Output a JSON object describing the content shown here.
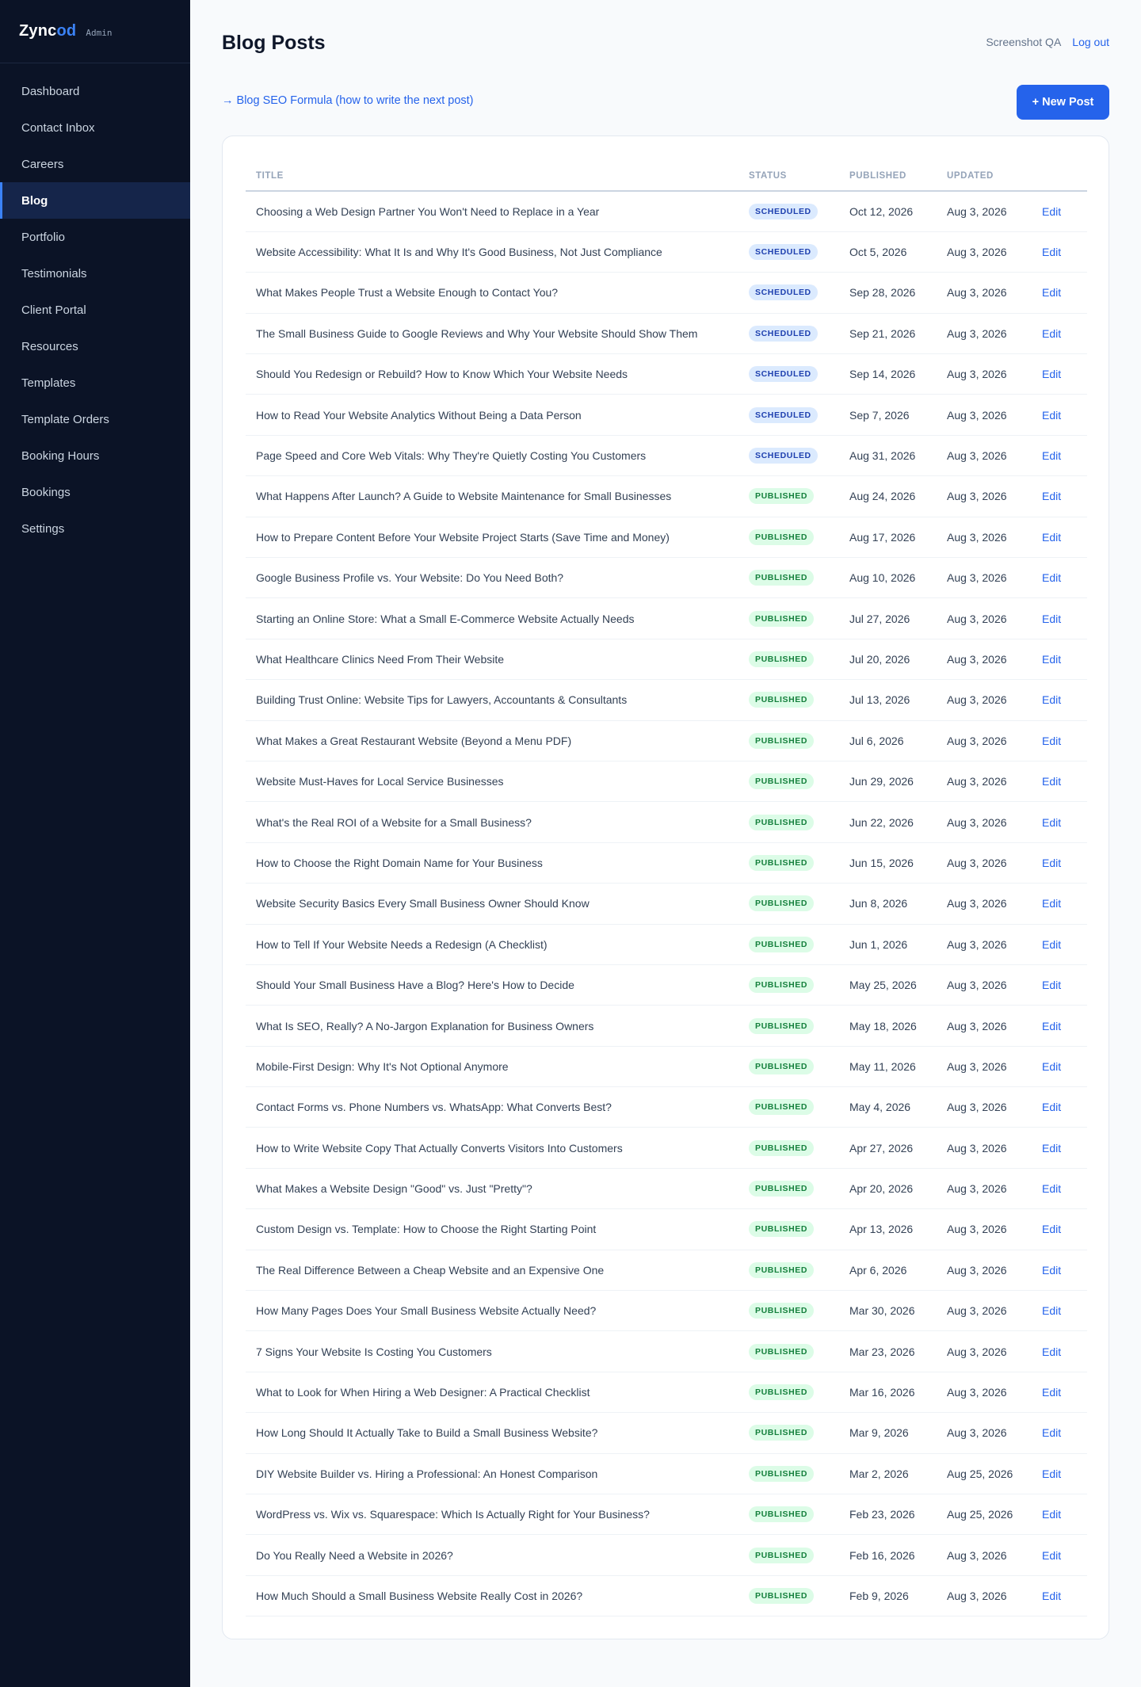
{
  "brand": {
    "name_main": "Zync",
    "name_accent": "od",
    "tag": "Admin",
    "accent_color": "#3b82f6"
  },
  "sidebar": {
    "items": [
      {
        "label": "Dashboard",
        "name": "sidebar-item-dashboard",
        "active": false
      },
      {
        "label": "Contact Inbox",
        "name": "sidebar-item-contact-inbox",
        "active": false
      },
      {
        "label": "Careers",
        "name": "sidebar-item-careers",
        "active": false
      },
      {
        "label": "Blog",
        "name": "sidebar-item-blog",
        "active": true
      },
      {
        "label": "Portfolio",
        "name": "sidebar-item-portfolio",
        "active": false
      },
      {
        "label": "Testimonials",
        "name": "sidebar-item-testimonials",
        "active": false
      },
      {
        "label": "Client Portal",
        "name": "sidebar-item-client-portal",
        "active": false
      },
      {
        "label": "Resources",
        "name": "sidebar-item-resources",
        "active": false
      },
      {
        "label": "Templates",
        "name": "sidebar-item-templates",
        "active": false
      },
      {
        "label": "Template Orders",
        "name": "sidebar-item-template-orders",
        "active": false
      },
      {
        "label": "Booking Hours",
        "name": "sidebar-item-booking-hours",
        "active": false
      },
      {
        "label": "Bookings",
        "name": "sidebar-item-bookings",
        "active": false
      },
      {
        "label": "Settings",
        "name": "sidebar-item-settings",
        "active": false
      }
    ]
  },
  "header": {
    "title": "Blog Posts",
    "user_name": "Screenshot QA",
    "logout_label": "Log out",
    "seo_link": "→ Blog SEO Formula (how to write the next post)",
    "new_post_label": "+ New Post"
  },
  "table": {
    "columns": [
      "TITLE",
      "STATUS",
      "PUBLISHED",
      "UPDATED"
    ],
    "edit_label": "Edit",
    "status_colors": {
      "SCHEDULED": "#1e40af",
      "PUBLISHED": "#15803d"
    },
    "rows": [
      {
        "title": "Choosing a Web Design Partner You Won't Need to Replace in a Year",
        "status": "SCHEDULED",
        "published": "Oct 12, 2026",
        "updated": "Aug 3, 2026"
      },
      {
        "title": "Website Accessibility: What It Is and Why It's Good Business, Not Just Compliance",
        "status": "SCHEDULED",
        "published": "Oct 5, 2026",
        "updated": "Aug 3, 2026"
      },
      {
        "title": "What Makes People Trust a Website Enough to Contact You?",
        "status": "SCHEDULED",
        "published": "Sep 28, 2026",
        "updated": "Aug 3, 2026"
      },
      {
        "title": "The Small Business Guide to Google Reviews and Why Your Website Should Show Them",
        "status": "SCHEDULED",
        "published": "Sep 21, 2026",
        "updated": "Aug 3, 2026"
      },
      {
        "title": "Should You Redesign or Rebuild? How to Know Which Your Website Needs",
        "status": "SCHEDULED",
        "published": "Sep 14, 2026",
        "updated": "Aug 3, 2026"
      },
      {
        "title": "How to Read Your Website Analytics Without Being a Data Person",
        "status": "SCHEDULED",
        "published": "Sep 7, 2026",
        "updated": "Aug 3, 2026"
      },
      {
        "title": "Page Speed and Core Web Vitals: Why They're Quietly Costing You Customers",
        "status": "SCHEDULED",
        "published": "Aug 31, 2026",
        "updated": "Aug 3, 2026"
      },
      {
        "title": "What Happens After Launch? A Guide to Website Maintenance for Small Businesses",
        "status": "PUBLISHED",
        "published": "Aug 24, 2026",
        "updated": "Aug 3, 2026"
      },
      {
        "title": "How to Prepare Content Before Your Website Project Starts (Save Time and Money)",
        "status": "PUBLISHED",
        "published": "Aug 17, 2026",
        "updated": "Aug 3, 2026"
      },
      {
        "title": "Google Business Profile vs. Your Website: Do You Need Both?",
        "status": "PUBLISHED",
        "published": "Aug 10, 2026",
        "updated": "Aug 3, 2026"
      },
      {
        "title": "Starting an Online Store: What a Small E-Commerce Website Actually Needs",
        "status": "PUBLISHED",
        "published": "Jul 27, 2026",
        "updated": "Aug 3, 2026"
      },
      {
        "title": "What Healthcare Clinics Need From Their Website",
        "status": "PUBLISHED",
        "published": "Jul 20, 2026",
        "updated": "Aug 3, 2026"
      },
      {
        "title": "Building Trust Online: Website Tips for Lawyers, Accountants & Consultants",
        "status": "PUBLISHED",
        "published": "Jul 13, 2026",
        "updated": "Aug 3, 2026"
      },
      {
        "title": "What Makes a Great Restaurant Website (Beyond a Menu PDF)",
        "status": "PUBLISHED",
        "published": "Jul 6, 2026",
        "updated": "Aug 3, 2026"
      },
      {
        "title": "Website Must-Haves for Local Service Businesses",
        "status": "PUBLISHED",
        "published": "Jun 29, 2026",
        "updated": "Aug 3, 2026"
      },
      {
        "title": "What's the Real ROI of a Website for a Small Business?",
        "status": "PUBLISHED",
        "published": "Jun 22, 2026",
        "updated": "Aug 3, 2026"
      },
      {
        "title": "How to Choose the Right Domain Name for Your Business",
        "status": "PUBLISHED",
        "published": "Jun 15, 2026",
        "updated": "Aug 3, 2026"
      },
      {
        "title": "Website Security Basics Every Small Business Owner Should Know",
        "status": "PUBLISHED",
        "published": "Jun 8, 2026",
        "updated": "Aug 3, 2026"
      },
      {
        "title": "How to Tell If Your Website Needs a Redesign (A Checklist)",
        "status": "PUBLISHED",
        "published": "Jun 1, 2026",
        "updated": "Aug 3, 2026"
      },
      {
        "title": "Should Your Small Business Have a Blog? Here's How to Decide",
        "status": "PUBLISHED",
        "published": "May 25, 2026",
        "updated": "Aug 3, 2026"
      },
      {
        "title": "What Is SEO, Really? A No-Jargon Explanation for Business Owners",
        "status": "PUBLISHED",
        "published": "May 18, 2026",
        "updated": "Aug 3, 2026"
      },
      {
        "title": "Mobile-First Design: Why It's Not Optional Anymore",
        "status": "PUBLISHED",
        "published": "May 11, 2026",
        "updated": "Aug 3, 2026"
      },
      {
        "title": "Contact Forms vs. Phone Numbers vs. WhatsApp: What Converts Best?",
        "status": "PUBLISHED",
        "published": "May 4, 2026",
        "updated": "Aug 3, 2026"
      },
      {
        "title": "How to Write Website Copy That Actually Converts Visitors Into Customers",
        "status": "PUBLISHED",
        "published": "Apr 27, 2026",
        "updated": "Aug 3, 2026"
      },
      {
        "title": "What Makes a Website Design \"Good\" vs. Just \"Pretty\"?",
        "status": "PUBLISHED",
        "published": "Apr 20, 2026",
        "updated": "Aug 3, 2026"
      },
      {
        "title": "Custom Design vs. Template: How to Choose the Right Starting Point",
        "status": "PUBLISHED",
        "published": "Apr 13, 2026",
        "updated": "Aug 3, 2026"
      },
      {
        "title": "The Real Difference Between a Cheap Website and an Expensive One",
        "status": "PUBLISHED",
        "published": "Apr 6, 2026",
        "updated": "Aug 3, 2026"
      },
      {
        "title": "How Many Pages Does Your Small Business Website Actually Need?",
        "status": "PUBLISHED",
        "published": "Mar 30, 2026",
        "updated": "Aug 3, 2026"
      },
      {
        "title": "7 Signs Your Website Is Costing You Customers",
        "status": "PUBLISHED",
        "published": "Mar 23, 2026",
        "updated": "Aug 3, 2026"
      },
      {
        "title": "What to Look for When Hiring a Web Designer: A Practical Checklist",
        "status": "PUBLISHED",
        "published": "Mar 16, 2026",
        "updated": "Aug 3, 2026"
      },
      {
        "title": "How Long Should It Actually Take to Build a Small Business Website?",
        "status": "PUBLISHED",
        "published": "Mar 9, 2026",
        "updated": "Aug 3, 2026"
      },
      {
        "title": "DIY Website Builder vs. Hiring a Professional: An Honest Comparison",
        "status": "PUBLISHED",
        "published": "Mar 2, 2026",
        "updated": "Aug 25, 2026"
      },
      {
        "title": "WordPress vs. Wix vs. Squarespace: Which Is Actually Right for Your Business?",
        "status": "PUBLISHED",
        "published": "Feb 23, 2026",
        "updated": "Aug 25, 2026"
      },
      {
        "title": "Do You Really Need a Website in 2026?",
        "status": "PUBLISHED",
        "published": "Feb 16, 2026",
        "updated": "Aug 3, 2026"
      },
      {
        "title": "How Much Should a Small Business Website Really Cost in 2026?",
        "status": "PUBLISHED",
        "published": "Feb 9, 2026",
        "updated": "Aug 3, 2026"
      }
    ]
  }
}
